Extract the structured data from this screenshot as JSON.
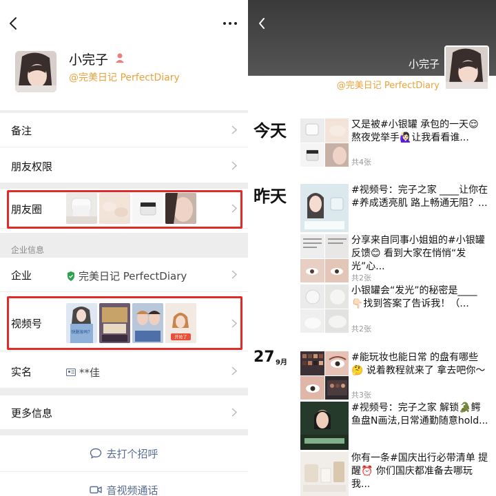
{
  "left": {
    "profile": {
      "name": "小完子",
      "company_tag": "@完美日记 PerfectDiary"
    },
    "rows": {
      "remark": "备注",
      "permissions": "朋友权限",
      "moments": "朋友圈",
      "enterprise_section": "企业信息",
      "enterprise": "企业",
      "enterprise_value": "完美日记 PerfectDiary",
      "channels": "视频号",
      "realname": "实名",
      "realname_value": "**佳",
      "more_info": "更多信息"
    },
    "actions": {
      "greet": "去打个招呼",
      "call": "音视频通话"
    },
    "channel_thumb_texts": [
      "快脱妆吗？",
      "开抢了"
    ]
  },
  "right": {
    "cover": {
      "name": "小完子",
      "company_tag": "@完美日记 PerfectDiary"
    },
    "days": {
      "today": "今天",
      "yesterday": "昨天",
      "day27": "27",
      "month9": "9月"
    },
    "posts": [
      {
        "text": "又是被#小银罐 承包的一天😌 熬夜党举手🙋🏻‍♀️让我看看谁...",
        "count": "共4张"
      },
      {
        "text": "#视频号：完子之家 ____让你在#养成透亮肌 路上畅通无阻？...",
        "count": ""
      },
      {
        "text": "分享来自同事小姐姐的#小银罐 反馈😊 看到大家在悄悄“发光”心...",
        "count": "共2张"
      },
      {
        "text": "小银罐会“发光”的秘密是____ 👇🏻找到答案了告诉我！（...",
        "count": "共2张"
      },
      {
        "text": "#能玩妆也能日常 的盘有哪些🤔 说着教程就来了 拿去吧你～",
        "count": "共3张"
      },
      {
        "text": "#视频号：完子之家 解锁🐊鳄鱼盘N画法,日常通勤随意hold...",
        "count": ""
      },
      {
        "text": "你有一条#国庆出行必带清单 提醒⏰ 你们国庆都准备去哪玩 我...",
        "count": ""
      }
    ]
  },
  "colors": {
    "accent_link": "#576b95",
    "company_orange": "#e9a23b",
    "highlight_red": "#e02b2b",
    "verify_green": "#2ba24c"
  }
}
